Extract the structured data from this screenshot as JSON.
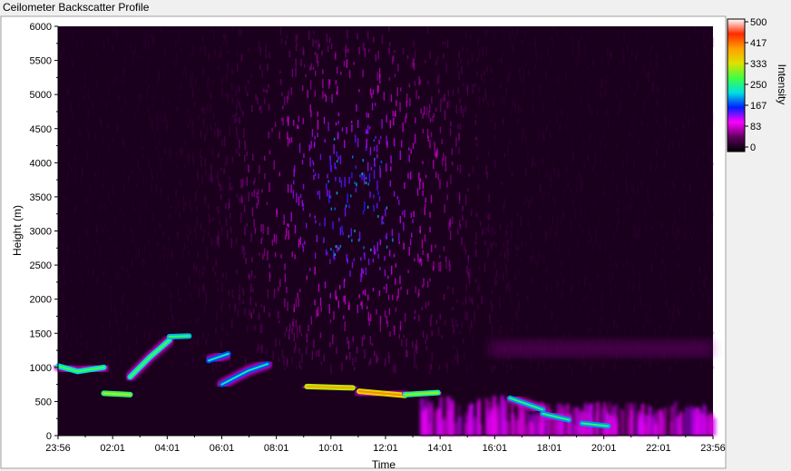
{
  "window": {
    "title": "Ceilometer Backscatter Profile"
  },
  "chart_data": {
    "type": "heatmap",
    "title": "Ceilometer Backscatter Profile",
    "xlabel": "Time",
    "ylabel": "Height (m)",
    "x_ticks": [
      "23:56",
      "02:01",
      "04:01",
      "06:01",
      "08:01",
      "10:01",
      "12:01",
      "14:01",
      "16:01",
      "18:01",
      "20:01",
      "22:01",
      "23:56"
    ],
    "y_ticks": [
      0,
      500,
      1000,
      1500,
      2000,
      2500,
      3000,
      3500,
      4000,
      4500,
      5000,
      5500,
      6000
    ],
    "ylim": [
      0,
      6000
    ],
    "colorbar": {
      "label": "Intensity",
      "range": [
        0,
        500
      ],
      "ticks": [
        "500",
        "417",
        "333",
        "250",
        "167",
        "83",
        "0"
      ],
      "colors": [
        "#ffffff",
        "#ff2a00",
        "#ffa000",
        "#e0e000",
        "#40ff40",
        "#00e0e0",
        "#0020ff",
        "#ff00ff",
        "#600060",
        "#000000"
      ]
    },
    "cloud_base_layers": [
      {
        "x": [
          0.0,
          0.03,
          0.07
        ],
        "y": [
          1020,
          940,
          1000
        ],
        "intensity": 220
      },
      {
        "x": [
          0.07,
          0.11
        ],
        "y": [
          620,
          600
        ],
        "intensity": 260
      },
      {
        "x": [
          0.11,
          0.14,
          0.17
        ],
        "y": [
          860,
          1150,
          1400
        ],
        "intensity": 220
      },
      {
        "x": [
          0.17,
          0.2
        ],
        "y": [
          1450,
          1460
        ],
        "intensity": 210
      },
      {
        "x": [
          0.23,
          0.26
        ],
        "y": [
          1100,
          1200
        ],
        "intensity": 180
      },
      {
        "x": [
          0.25,
          0.29,
          0.32
        ],
        "y": [
          750,
          950,
          1050
        ],
        "intensity": 180
      },
      {
        "x": [
          0.38,
          0.45
        ],
        "y": [
          720,
          700
        ],
        "intensity": 320
      },
      {
        "x": [
          0.46,
          0.53
        ],
        "y": [
          650,
          590
        ],
        "intensity": 340
      },
      {
        "x": [
          0.53,
          0.58
        ],
        "y": [
          600,
          630
        ],
        "intensity": 250
      },
      {
        "x": [
          0.69,
          0.74
        ],
        "y": [
          550,
          380
        ],
        "intensity": 200
      },
      {
        "x": [
          0.74,
          0.78
        ],
        "y": [
          320,
          230
        ],
        "intensity": 200
      },
      {
        "x": [
          0.8,
          0.84
        ],
        "y": [
          180,
          140
        ],
        "intensity": 200
      }
    ],
    "noise_peak_time": "11:00",
    "noise_peak_height": 3500
  }
}
